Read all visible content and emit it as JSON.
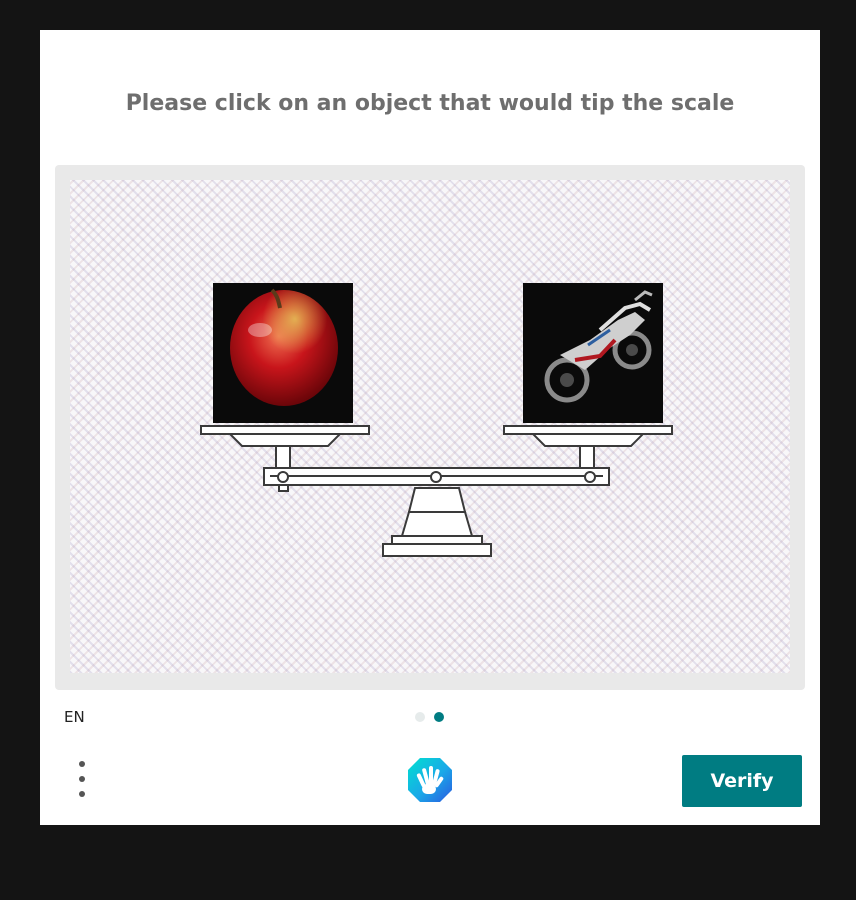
{
  "challenge": {
    "prompt": "Please click on an object that would tip the scale"
  },
  "task": {
    "left_object_icon": "apple-icon",
    "right_object_icon": "motorcycle-icon"
  },
  "footer": {
    "language": "EN",
    "verify_label": "Verify",
    "menu_icon": "more-vertical-icon",
    "logo_icon": "hand-logo-icon",
    "page_indicator": {
      "total": 2,
      "current": 2
    }
  },
  "colors": {
    "accent": "#007c82",
    "prompt_text": "#6e6e6e",
    "frame": "#e9e9e9",
    "backdrop": "#141414"
  }
}
